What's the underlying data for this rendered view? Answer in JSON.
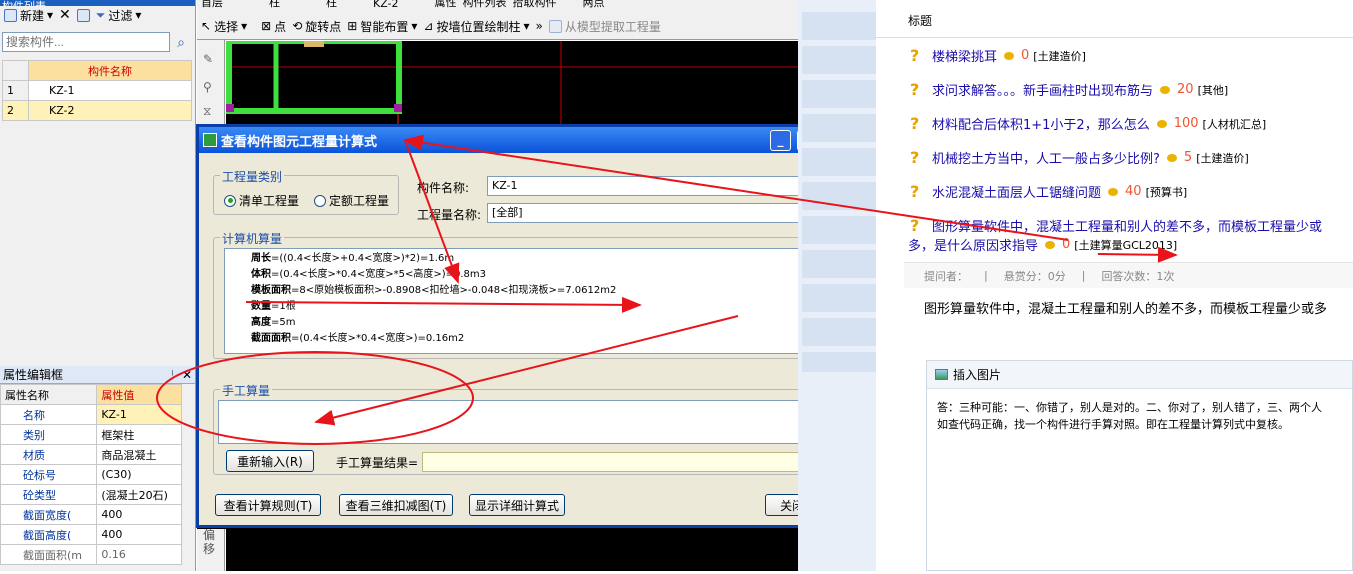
{
  "left_panel": {
    "title": "构件列表",
    "toolbar": {
      "new_label": "新建",
      "filter_label": "过滤"
    },
    "search_placeholder": "搜索构件...",
    "column_header": "构件名称",
    "rows": [
      {
        "num": "1",
        "name": "KZ-1"
      },
      {
        "num": "2",
        "name": "KZ-2"
      }
    ]
  },
  "property_panel": {
    "title": "属性编辑框",
    "pin": "ᛌ",
    "col_name": "属性名称",
    "col_value": "属性值",
    "rows": [
      {
        "num": "1",
        "name": "名称",
        "value": "KZ-1"
      },
      {
        "num": "2",
        "name": "类别",
        "value": "框架柱"
      },
      {
        "num": "3",
        "name": "材质",
        "value": "商品混凝土"
      },
      {
        "num": "4",
        "name": "砼标号",
        "value": "(C30)"
      },
      {
        "num": "5",
        "name": "砼类型",
        "value": "(混凝土20石)"
      },
      {
        "num": "6",
        "name": "截面宽度(",
        "value": "400"
      },
      {
        "num": "7",
        "name": "截面高度(",
        "value": "400"
      },
      {
        "num": "8",
        "name": "截面面积(m",
        "value": "0.16"
      }
    ]
  },
  "cad_toolbar": {
    "row1": {
      "floor": "首层",
      "type": "柱",
      "type2": "柱",
      "item": "KZ-2",
      "props": "属性",
      "list": "构件列表",
      "pick": "拾取构件",
      "grid": "两点"
    },
    "row2": {
      "select": "选择",
      "point": "点",
      "rotate": "旋转点",
      "smart": "智能布置",
      "wall": "按墙位置绘制柱",
      "extract": "从模型提取工程量",
      "more": "»"
    },
    "side_label": "偏移"
  },
  "dialog": {
    "title": "查看构件图元工程量计算式",
    "category_label": "工程量类别",
    "radio_qingdan": "清单工程量",
    "radio_dinge": "定额工程量",
    "component_name_label": "构件名称:",
    "component_name_value": "KZ-1",
    "qty_name_label": "工程量名称:",
    "qty_name_value": "[全部]",
    "computer_calc_label": "计算机算量",
    "calc_lines": [
      {
        "key": "周长",
        "expr": "=((0.4<长度>+0.4<宽度>)*2)=1.6m"
      },
      {
        "key": "体积",
        "expr": "=(0.4<长度>*0.4<宽度>*5<高度>)=0.8m3"
      },
      {
        "key": "模板面积",
        "expr": "=8<原始模板面积>-0.8908<扣砼墙>-0.048<扣现浇板>=7.0612m2"
      },
      {
        "key": "数量",
        "expr": "=1根"
      },
      {
        "key": "高度",
        "expr": "=5m"
      },
      {
        "key": "截面面积",
        "expr": "=(0.4<长度>*0.4<宽度>)=0.16m2"
      }
    ],
    "manual_calc_label": "手工算量",
    "reenter_label": "重新输入(R)",
    "manual_result_label": "手工算量结果=",
    "btn_rules": "查看计算规则(T)",
    "btn_3d": "查看三维扣减图(T)",
    "btn_detail": "显示详细计算式",
    "btn_close": "关闭(C)"
  },
  "qa": {
    "header": "标题",
    "items": [
      {
        "title": "楼梯梁挑耳",
        "score": "0",
        "tag": "[土建造价]"
      },
      {
        "title": "求问求解答。。。新手画柱时出现布筋与",
        "score": "20",
        "tag": "[其他]"
      },
      {
        "title": "材料配合后体积1+1小于2，那么怎么",
        "score": "100",
        "tag": "[人材机汇总]"
      },
      {
        "title": "机械挖土方当中，人工一般占多少比例?",
        "score": "5",
        "tag": "[土建造价]"
      },
      {
        "title": "水泥混凝土面层人工锯缝问题",
        "score": "40",
        "tag": "[预算书]"
      },
      {
        "title": "图形算量软件中，混凝土工程量和别人的差不多，而模板工程量少或",
        "title2": "多，是什么原因求指导",
        "score": "0",
        "tag": "[土建算量GCL2013]"
      }
    ],
    "meta": {
      "asker": "提问者：",
      "reward": "悬赏分：0分",
      "answers": "回答次数：1次"
    },
    "question_text": "图形算量软件中，混凝土工程量和别人的差不多，而模板工程量少或多",
    "insert_image": "插入图片",
    "answer_line1": "答：三种可能：一、你错了，别人是对的。二、你对了，别人错了，三、两个人",
    "answer_line2": "如查代码正确，找一个构件进行手算对照。即在工程量计算列式中复核。"
  },
  "colors": {
    "annotation": "#e8141b",
    "dialog_blue": "#0a52d8",
    "header_fill": "#fce0a0"
  }
}
